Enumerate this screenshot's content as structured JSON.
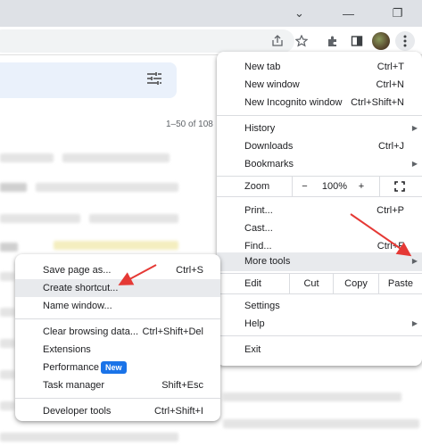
{
  "window": {
    "minimize_glyph": "—",
    "chevron_glyph": "⌄",
    "restore_glyph": "❐"
  },
  "toolbar_icons": [
    "share-icon",
    "star-icon",
    "extensions-icon",
    "side-panel-icon",
    "profile-avatar",
    "kebab-menu-icon"
  ],
  "page": {
    "pager_text": "1–50 of 108"
  },
  "menu": {
    "items": [
      {
        "label": "New tab",
        "shortcut": "Ctrl+T"
      },
      {
        "label": "New window",
        "shortcut": "Ctrl+N"
      },
      {
        "label": "New Incognito window",
        "shortcut": "Ctrl+Shift+N"
      },
      {
        "label": "History",
        "shortcut": ""
      },
      {
        "label": "Downloads",
        "shortcut": "Ctrl+J"
      },
      {
        "label": "Bookmarks",
        "shortcut": ""
      },
      {
        "label": "Print...",
        "shortcut": "Ctrl+P"
      },
      {
        "label": "Cast...",
        "shortcut": ""
      },
      {
        "label": "Find...",
        "shortcut": "Ctrl+F"
      },
      {
        "label": "More tools",
        "shortcut": ""
      },
      {
        "label": "Settings",
        "shortcut": ""
      },
      {
        "label": "Help",
        "shortcut": ""
      },
      {
        "label": "Exit",
        "shortcut": ""
      }
    ],
    "zoom": {
      "label": "Zoom",
      "minus": "−",
      "value": "100%",
      "plus": "+"
    },
    "edit": {
      "label": "Edit",
      "cut": "Cut",
      "copy": "Copy",
      "paste": "Paste"
    }
  },
  "submenu": {
    "items": [
      {
        "label": "Save page as...",
        "shortcut": "Ctrl+S"
      },
      {
        "label": "Create shortcut...",
        "shortcut": ""
      },
      {
        "label": "Name window...",
        "shortcut": ""
      },
      {
        "label": "Clear browsing data...",
        "shortcut": "Ctrl+Shift+Del"
      },
      {
        "label": "Extensions",
        "shortcut": ""
      },
      {
        "label": "Performance",
        "shortcut": "",
        "badge": "New"
      },
      {
        "label": "Task manager",
        "shortcut": "Shift+Esc"
      },
      {
        "label": "Developer tools",
        "shortcut": "Ctrl+Shift+I"
      }
    ]
  },
  "colors": {
    "highlight": "#e8eaed",
    "badge": "#1a73e8",
    "annotation_arrow": "#e53935"
  }
}
